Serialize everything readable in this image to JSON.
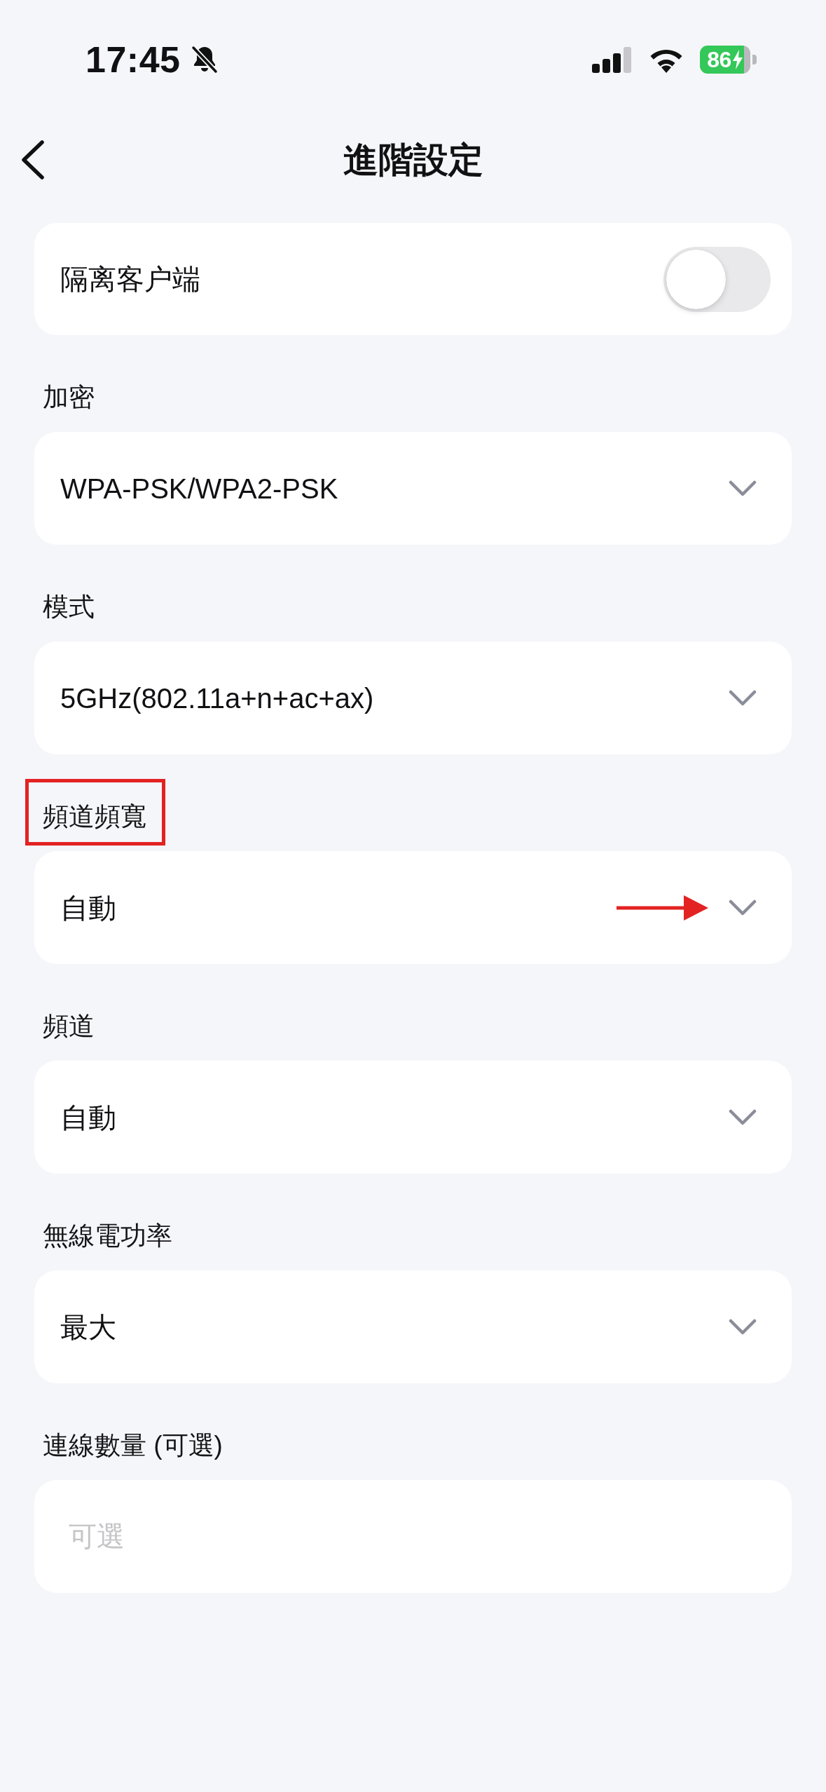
{
  "status_bar": {
    "time": "17:45",
    "battery": "86"
  },
  "header": {
    "title": "進階設定"
  },
  "toggle_row": {
    "label": "隔离客户端",
    "on": false
  },
  "fields": [
    {
      "kind": "select",
      "label": "加密",
      "value": "WPA-PSK/WPA2-PSK",
      "highlighted": false,
      "arrow_marked": false
    },
    {
      "kind": "select",
      "label": "模式",
      "value": "5GHz(802.11a+n+ac+ax)",
      "highlighted": false,
      "arrow_marked": false
    },
    {
      "kind": "select",
      "label": "頻道頻寬",
      "value": "自動",
      "highlighted": true,
      "arrow_marked": true
    },
    {
      "kind": "select",
      "label": "頻道",
      "value": "自動",
      "highlighted": false,
      "arrow_marked": false
    },
    {
      "kind": "select",
      "label": "無線電功率",
      "value": "最大",
      "highlighted": false,
      "arrow_marked": false
    },
    {
      "kind": "input",
      "label": "連線數量 (可選)",
      "placeholder": "可選",
      "highlighted": false,
      "arrow_marked": false
    }
  ]
}
